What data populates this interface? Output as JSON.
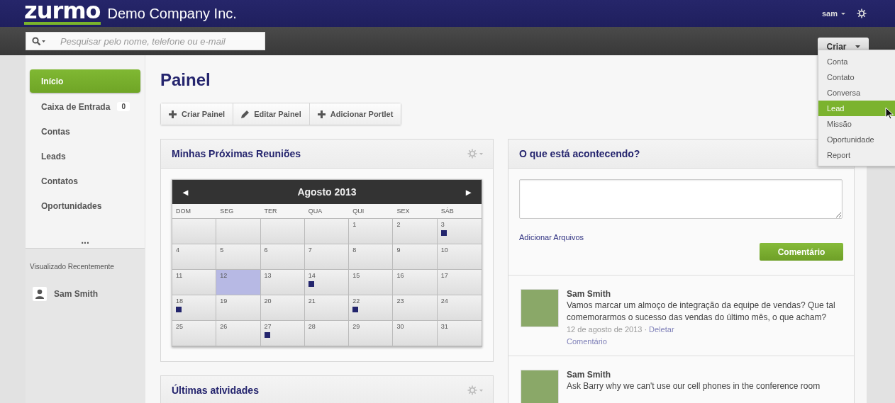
{
  "header": {
    "logo": "zurmo",
    "company": "Demo Company Inc.",
    "user": "sam"
  },
  "search": {
    "placeholder": "Pesquisar pelo nome, telefone ou e-mail"
  },
  "create_menu": {
    "label": "Criar",
    "expanded": true,
    "items": [
      {
        "label": "Conta",
        "selected": false
      },
      {
        "label": "Contato",
        "selected": false
      },
      {
        "label": "Conversa",
        "selected": false
      },
      {
        "label": "Lead",
        "selected": true
      },
      {
        "label": "Missão",
        "selected": false
      },
      {
        "label": "Oportunidade",
        "selected": false
      },
      {
        "label": "Report",
        "selected": false
      }
    ]
  },
  "sidebar": {
    "items": [
      {
        "label": "Início",
        "selected": true
      },
      {
        "label": "Caixa de Entrada",
        "selected": false,
        "badge": "0"
      },
      {
        "label": "Contas",
        "selected": false
      },
      {
        "label": "Leads",
        "selected": false
      },
      {
        "label": "Contatos",
        "selected": false
      },
      {
        "label": "Oportunidades",
        "selected": false
      }
    ],
    "more": "...",
    "recent_title": "Visualizado Recentemente",
    "recent": [
      "Sam Smith"
    ]
  },
  "page_title": "Painel",
  "toolbar": [
    {
      "label": "Criar Painel",
      "kind": "plus"
    },
    {
      "label": "Editar Painel",
      "kind": "pencil"
    },
    {
      "label": "Adicionar Portlet",
      "kind": "plus"
    }
  ],
  "meetings": {
    "title": "Minhas Próximas Reuniões",
    "month": "Agosto 2013",
    "prev": "◄",
    "next": "►",
    "weekdays": [
      "DOM",
      "SEG",
      "TER",
      "QUA",
      "QUI",
      "SEX",
      "SÁB"
    ],
    "weeks": [
      [
        {
          "kind": "blank"
        },
        {
          "kind": "blank"
        },
        {
          "kind": "blank"
        },
        {
          "kind": "blank"
        },
        {
          "kind": "day",
          "day": "1",
          "event": false,
          "selected": false
        },
        {
          "kind": "day",
          "day": "2",
          "event": false,
          "selected": false
        },
        {
          "kind": "day",
          "day": "3",
          "event": true,
          "selected": false
        }
      ],
      [
        {
          "kind": "day",
          "day": "4",
          "event": false,
          "selected": false
        },
        {
          "kind": "day",
          "day": "5",
          "event": false,
          "selected": false
        },
        {
          "kind": "day",
          "day": "6",
          "event": false,
          "selected": false
        },
        {
          "kind": "day",
          "day": "7",
          "event": false,
          "selected": false
        },
        {
          "kind": "day",
          "day": "8",
          "event": false,
          "selected": false
        },
        {
          "kind": "day",
          "day": "9",
          "event": false,
          "selected": false
        },
        {
          "kind": "day",
          "day": "10",
          "event": false,
          "selected": false
        }
      ],
      [
        {
          "kind": "day",
          "day": "11",
          "event": false,
          "selected": false
        },
        {
          "kind": "day",
          "day": "12",
          "event": false,
          "selected": true
        },
        {
          "kind": "day",
          "day": "13",
          "event": false,
          "selected": false
        },
        {
          "kind": "day",
          "day": "14",
          "event": true,
          "selected": false
        },
        {
          "kind": "day",
          "day": "15",
          "event": false,
          "selected": false
        },
        {
          "kind": "day",
          "day": "16",
          "event": false,
          "selected": false
        },
        {
          "kind": "day",
          "day": "17",
          "event": false,
          "selected": false
        }
      ],
      [
        {
          "kind": "day",
          "day": "18",
          "event": true,
          "selected": false
        },
        {
          "kind": "day",
          "day": "19",
          "event": false,
          "selected": false
        },
        {
          "kind": "day",
          "day": "20",
          "event": false,
          "selected": false
        },
        {
          "kind": "day",
          "day": "21",
          "event": false,
          "selected": false
        },
        {
          "kind": "day",
          "day": "22",
          "event": true,
          "selected": false
        },
        {
          "kind": "day",
          "day": "23",
          "event": false,
          "selected": false
        },
        {
          "kind": "day",
          "day": "24",
          "event": false,
          "selected": false
        }
      ],
      [
        {
          "kind": "day",
          "day": "25",
          "event": false,
          "selected": false
        },
        {
          "kind": "day",
          "day": "26",
          "event": false,
          "selected": false
        },
        {
          "kind": "day",
          "day": "27",
          "event": true,
          "selected": false
        },
        {
          "kind": "day",
          "day": "28",
          "event": false,
          "selected": false
        },
        {
          "kind": "day",
          "day": "29",
          "event": false,
          "selected": false
        },
        {
          "kind": "day",
          "day": "30",
          "event": false,
          "selected": false
        },
        {
          "kind": "day",
          "day": "31",
          "event": false,
          "selected": false
        }
      ]
    ]
  },
  "activities": {
    "title": "Últimas atividades"
  },
  "feed": {
    "title": "O que está acontecendo?",
    "attach": "Adicionar Arquivos",
    "submit": "Comentário",
    "posts": [
      {
        "author": "Sam Smith",
        "text": "Vamos marcar um almoço de integração da equipe de vendas? Que tal comemorarmos o sucesso das vendas do último mês, o que acham?",
        "date": "12 de agosto de 2013",
        "separator": "·",
        "delete": "Deletar",
        "comment": "Comentário"
      },
      {
        "author": "Sam Smith",
        "text": "Ask Barry why we can't use our cell phones in the conference room"
      }
    ]
  }
}
